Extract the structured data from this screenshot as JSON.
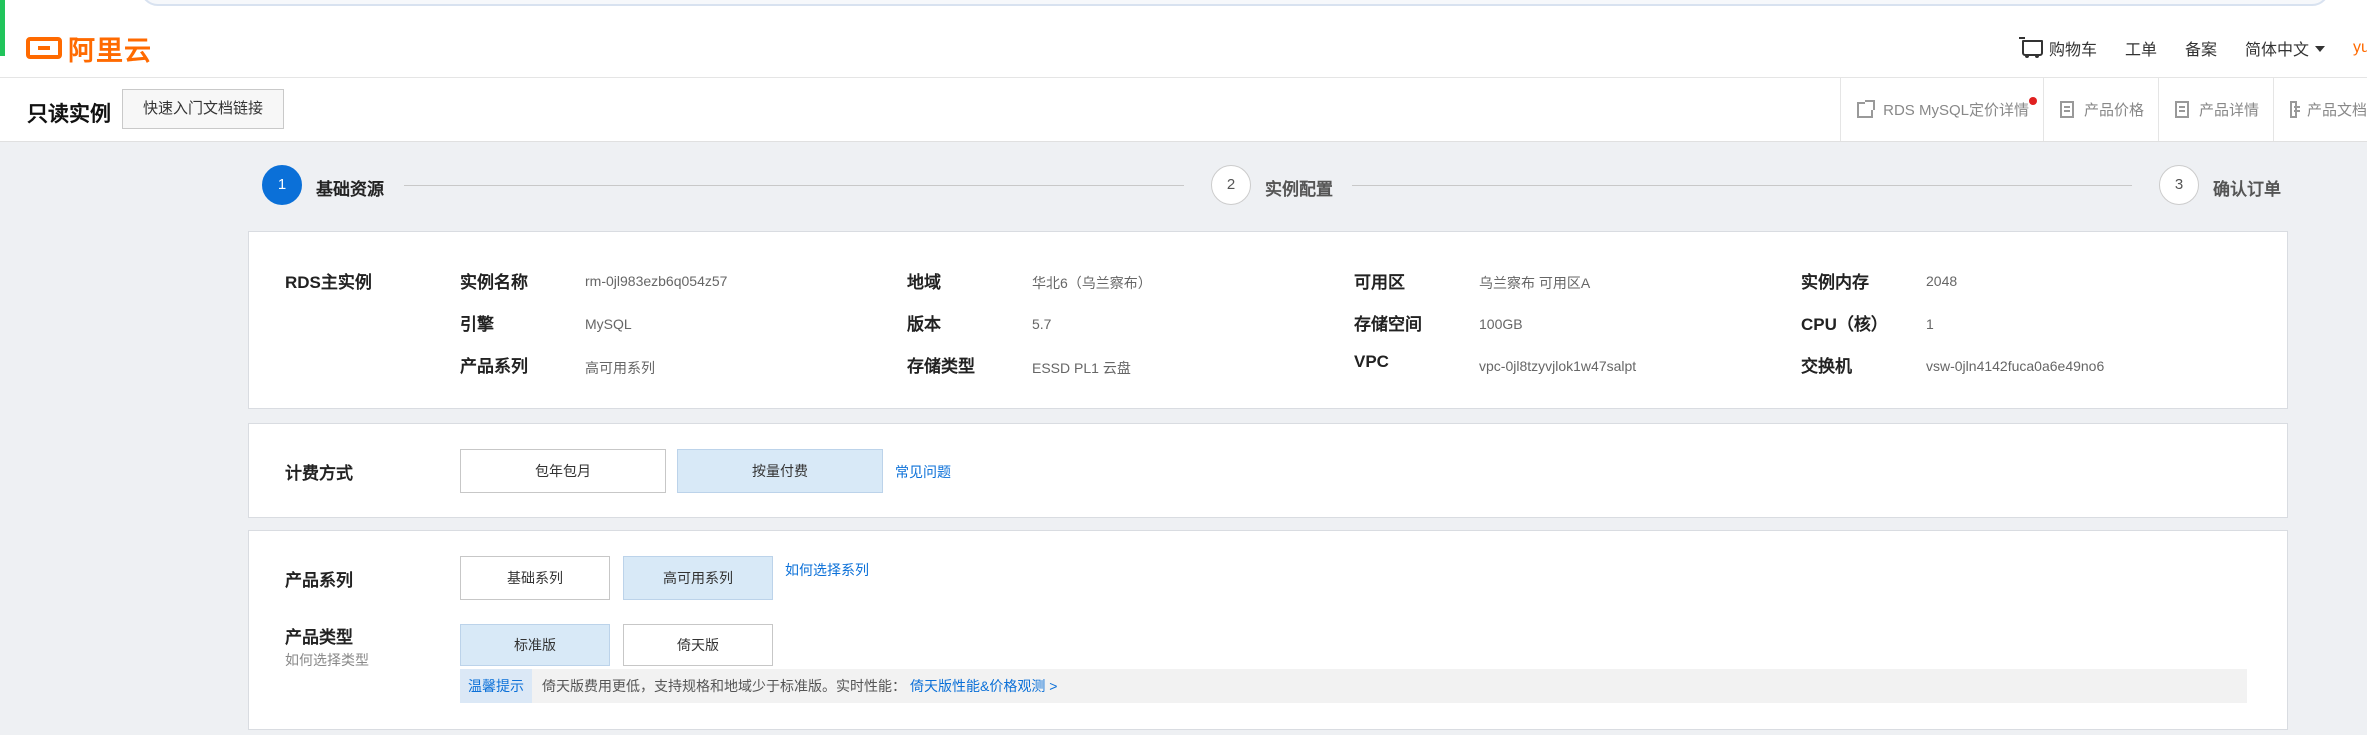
{
  "header": {
    "logo_text": "阿里云",
    "cart_label": "购物车",
    "ticket_label": "工单",
    "filing_label": "备案",
    "language_label": "简体中文",
    "user_text": "yu"
  },
  "subheader": {
    "title": "只读实例",
    "quick_link_label": "快速入门文档链接",
    "nav": [
      {
        "label": "RDS MySQL定价详情",
        "icon": "external-link-icon"
      },
      {
        "label": "产品价格",
        "icon": "document-icon"
      },
      {
        "label": "产品详情",
        "icon": "bookmark-icon"
      },
      {
        "label": "产品文档",
        "icon": "document-icon"
      }
    ]
  },
  "steps": [
    {
      "number": "1",
      "label": "基础资源",
      "active": true
    },
    {
      "number": "2",
      "label": "实例配置",
      "active": false
    },
    {
      "number": "3",
      "label": "确认订单",
      "active": false
    }
  ],
  "main_instance": {
    "section_label": "RDS主实例",
    "fields": [
      {
        "key": "实例名称",
        "value": "rm-0jl983ezb6q054z57"
      },
      {
        "key": "地域",
        "value": "华北6（乌兰察布）"
      },
      {
        "key": "可用区",
        "value": "乌兰察布 可用区A"
      },
      {
        "key": "实例内存",
        "value": "2048"
      },
      {
        "key": "引擎",
        "value": "MySQL"
      },
      {
        "key": "版本",
        "value": "5.7"
      },
      {
        "key": "存储空间",
        "value": "100GB"
      },
      {
        "key": "CPU（核）",
        "value": "1"
      },
      {
        "key": "产品系列",
        "value": "高可用系列"
      },
      {
        "key": "存储类型",
        "value": "ESSD PL1 云盘"
      },
      {
        "key": "VPC",
        "value": "vpc-0jl8tzyvjlok1w47salpt"
      },
      {
        "key": "交换机",
        "value": "vsw-0jln4142fuca0a6e49no6"
      }
    ]
  },
  "billing": {
    "label": "计费方式",
    "options": [
      {
        "label": "包年包月",
        "selected": false
      },
      {
        "label": "按量付费",
        "selected": true
      }
    ],
    "faq_link": "常见问题"
  },
  "product": {
    "series_label": "产品系列",
    "series_options": [
      {
        "label": "基础系列",
        "selected": false
      },
      {
        "label": "高可用系列",
        "selected": true
      }
    ],
    "series_help_link": "如何选择系列",
    "type_label": "产品类型",
    "type_sublabel": "如何选择类型",
    "type_options": [
      {
        "label": "标准版",
        "selected": true
      },
      {
        "label": "倚天版",
        "selected": false
      }
    ],
    "tip_tag": "温馨提示",
    "tip_text": "倚天版费用更低，支持规格和地域少于标准版。实时性能：",
    "tip_link": "倚天版性能&价格观测 >"
  },
  "colors": {
    "brand": "#ff6a00",
    "primary": "#0b70d8",
    "selected_bg": "#d8e9f7"
  }
}
